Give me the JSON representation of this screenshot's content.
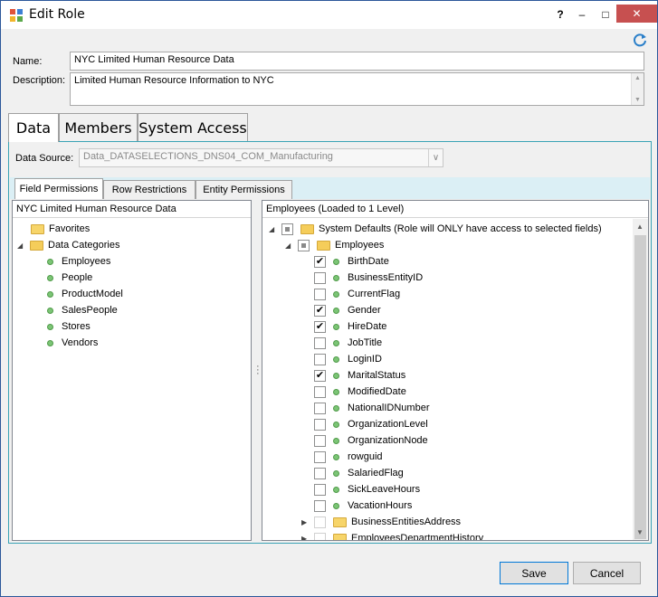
{
  "window": {
    "title": "Edit Role",
    "help": "?",
    "minimize": "–",
    "maximize": "□",
    "close": "✕"
  },
  "form": {
    "name_label": "Name:",
    "name_value": "NYC Limited Human Resource Data",
    "description_label": "Description:",
    "description_value": "Limited Human Resource Information to NYC"
  },
  "main_tabs": [
    "Data",
    "Members",
    "System Access"
  ],
  "data_source": {
    "label": "Data Source:",
    "value": "Data_DATASELECTIONS_DNS04_COM_Manufacturing",
    "dropdown_glyph": "∨"
  },
  "sub_tabs": [
    "Field Permissions",
    "Row Restrictions",
    "Entity Permissions"
  ],
  "left_pane": {
    "header": "NYC Limited Human Resource Data",
    "favorites": "Favorites",
    "data_categories": "Data Categories",
    "categories": [
      "Employees",
      "People",
      "ProductModel",
      "SalesPeople",
      "Stores",
      "Vendors"
    ],
    "collapse_glyph": "◢"
  },
  "right_pane": {
    "header": "Employees (Loaded to 1 Level)",
    "system_defaults": "System Defaults (Role will ONLY have access to selected fields)",
    "employees_folder": "Employees",
    "fields": [
      {
        "label": "BirthDate",
        "checked": "✔"
      },
      {
        "label": "BusinessEntityID",
        "checked": ""
      },
      {
        "label": "CurrentFlag",
        "checked": ""
      },
      {
        "label": "Gender",
        "checked": "✔"
      },
      {
        "label": "HireDate",
        "checked": "✔"
      },
      {
        "label": "JobTitle",
        "checked": ""
      },
      {
        "label": "LoginID",
        "checked": ""
      },
      {
        "label": "MaritalStatus",
        "checked": "✔"
      },
      {
        "label": "ModifiedDate",
        "checked": ""
      },
      {
        "label": "NationalIDNumber",
        "checked": ""
      },
      {
        "label": "OrganizationLevel",
        "checked": ""
      },
      {
        "label": "OrganizationNode",
        "checked": ""
      },
      {
        "label": "rowguid",
        "checked": ""
      },
      {
        "label": "SalariedFlag",
        "checked": ""
      },
      {
        "label": "SickLeaveHours",
        "checked": ""
      },
      {
        "label": "VacationHours",
        "checked": ""
      }
    ],
    "sub_folders": [
      "BusinessEntitiesAddress",
      "EmployeesDepartmentHistory"
    ],
    "expand_glyph": "▶",
    "collapse_glyph": "◢"
  },
  "footer": {
    "save": "Save",
    "cancel": "Cancel"
  },
  "colors": {
    "accent": "#0078d7",
    "panel_border": "#3aa3b5",
    "close_button": "#c75050",
    "status_dot": "#7cc576"
  }
}
